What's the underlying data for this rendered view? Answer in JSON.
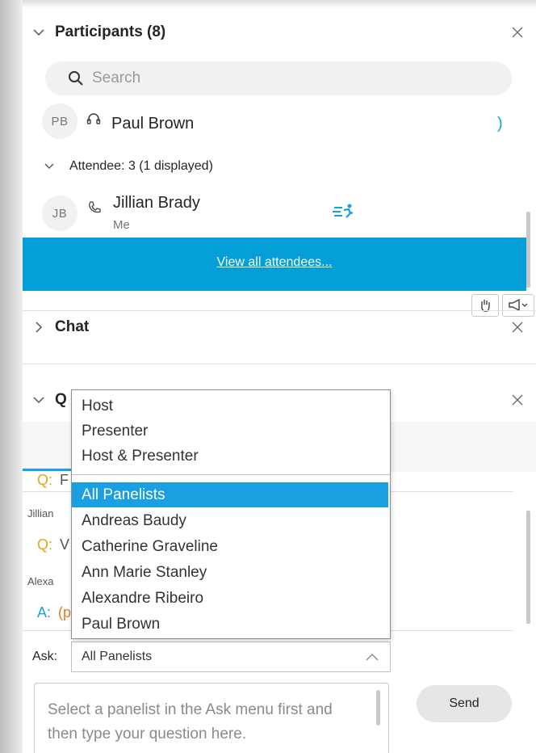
{
  "participants": {
    "title": "Participants (8)",
    "search_placeholder": "Search",
    "panelist": {
      "initials": "PB",
      "name": "Paul Brown",
      "trailing": ")"
    },
    "attendee_group": "Attendee: 3 (1 displayed)",
    "attendee": {
      "initials": "JB",
      "name": "Jillian Brady",
      "sub": "Me"
    },
    "view_all": "View all attendees..."
  },
  "chat": {
    "title": "Chat"
  },
  "qa": {
    "title_fragment": "Q",
    "q1_prefix": "Q:",
    "q1_fragment": "F",
    "author1_fragment": "Jillian",
    "q2_prefix": "Q:",
    "q2_fragment": "V",
    "author2_fragment": "Alexa",
    "a_prefix": "A:",
    "a_fragment": "(p"
  },
  "ask": {
    "label": "Ask:",
    "selected": "All Panelists",
    "options_group1": [
      "Host",
      "Presenter",
      "Host & Presenter"
    ],
    "options_group2": [
      "All Panelists",
      "Andreas Baudy",
      "Catherine Graveline",
      "Ann Marie Stanley",
      "Alexandre Ribeiro",
      "Paul Brown"
    ],
    "input_placeholder": "Select a panelist in the Ask menu first and then type your question here.",
    "send_label": "Send"
  },
  "colors": {
    "accent": "#049fd9",
    "selection": "#1a9fe0",
    "question_prefix": "#e8a317",
    "answer_prefix": "#1a9fe0"
  }
}
